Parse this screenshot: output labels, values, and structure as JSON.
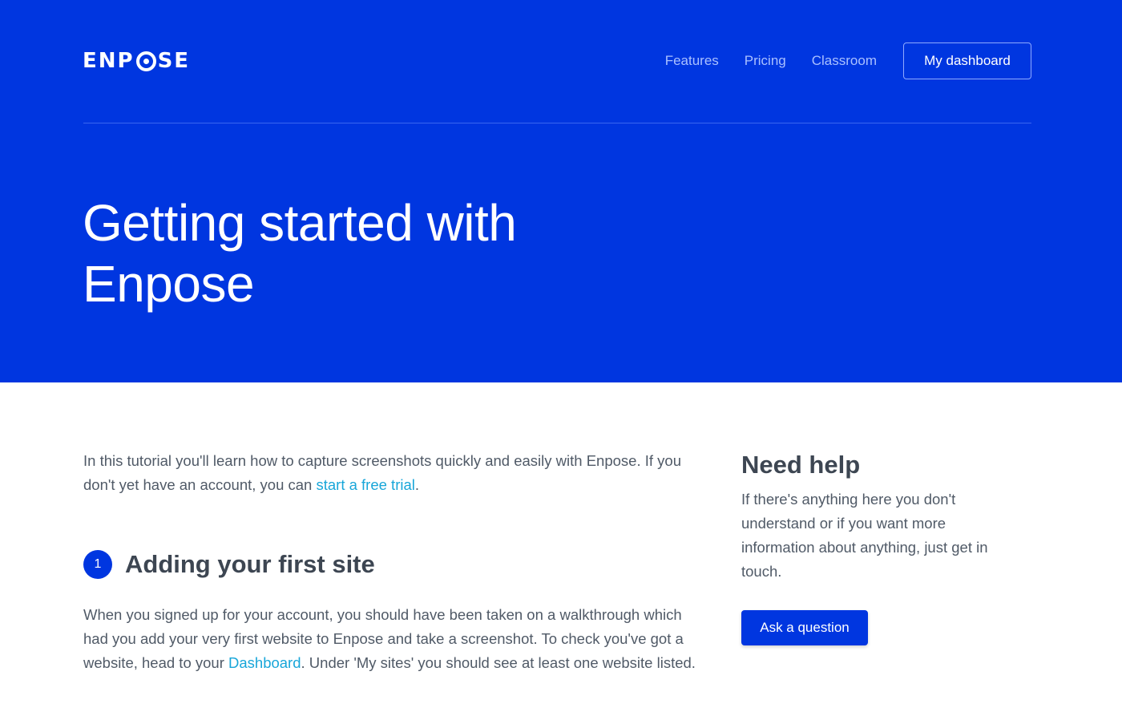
{
  "header": {
    "logo_left": "ENP",
    "logo_right": "SE",
    "nav": {
      "features": "Features",
      "pricing": "Pricing",
      "classroom": "Classroom",
      "dashboard_button": "My dashboard"
    }
  },
  "hero": {
    "title": "Getting started with Enpose"
  },
  "intro": {
    "text_before": "In this tutorial you'll learn how to capture screenshots quickly and easily with Enpose. If you don't yet have an account, you can ",
    "link": "start a free trial",
    "text_after": "."
  },
  "step1": {
    "number": "1",
    "title": "Adding your first site",
    "text_before": "When you signed up for your account, you should have been taken on a walkthrough which had you add your very first website to Enpose and take a screenshot. To check you've got a website, head to your ",
    "link": "Dashboard",
    "text_after": ". Under 'My sites' you should see at least one website listed."
  },
  "help": {
    "title": "Need help",
    "text": "If there's anything here you don't understand or if you want more information about anything, just get in touch.",
    "button": "Ask a question"
  },
  "colors": {
    "brand_blue": "#0036e0",
    "link": "#18a6d9",
    "nav_text": "#a9c0ff",
    "body_text": "#505a67",
    "heading_text": "#3d4652"
  }
}
